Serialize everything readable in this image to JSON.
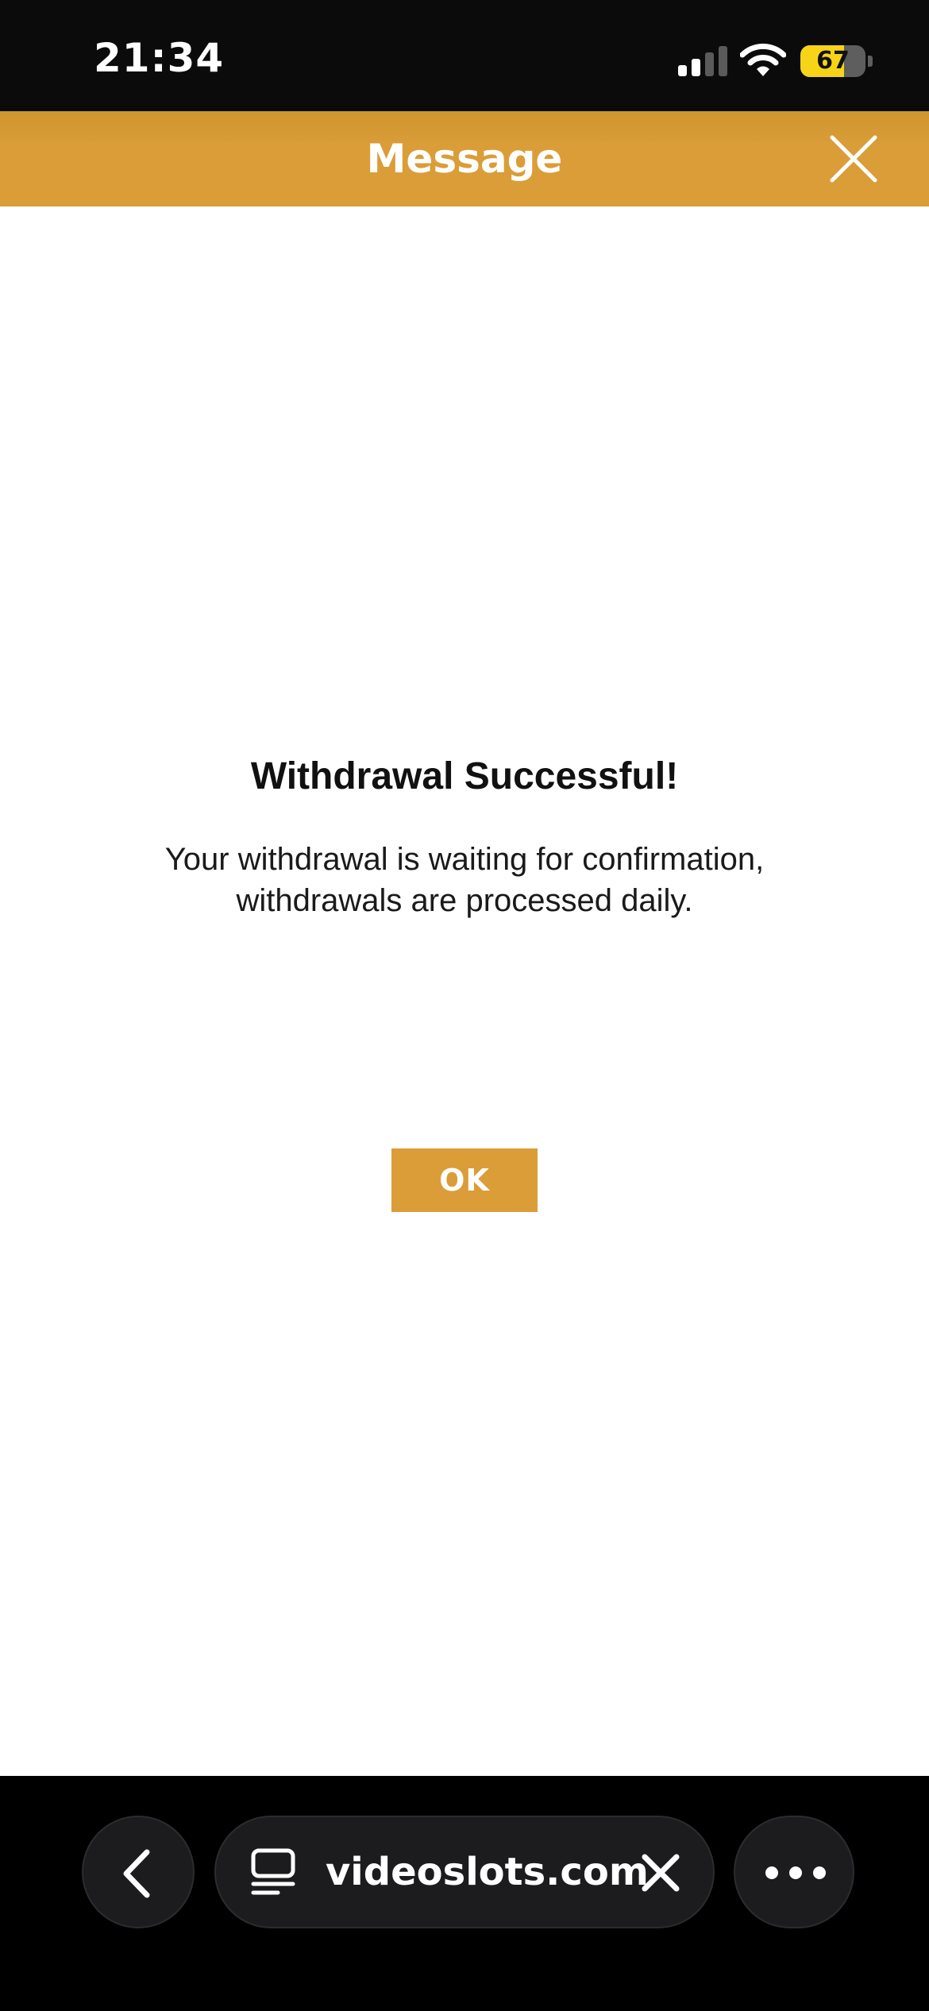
{
  "status_bar": {
    "time": "21:34",
    "battery_level": "67",
    "battery_fraction": 0.67,
    "signal_bars_active": 2,
    "signal_bars_total": 4,
    "icons": [
      "cellular-signal-icon",
      "wifi-icon",
      "battery-icon"
    ]
  },
  "header": {
    "title": "Message",
    "close_icon": "close-icon"
  },
  "dialog": {
    "title": "Withdrawal Successful!",
    "body_line1": "Your withdrawal is waiting for confirmation,",
    "body_line2": "withdrawals are processed daily.",
    "ok_label": "OK"
  },
  "browser_toolbar": {
    "url": "videoslots.com",
    "icons": [
      "back-icon",
      "tab-icon",
      "clear-url-icon",
      "more-icon"
    ]
  },
  "colors": {
    "accent": "#DA9D37",
    "status_bar_bg": "#0B0B0B",
    "content_bg": "#FFFFFF",
    "toolbar_bg": "#000000",
    "battery_fill": "#F7D417"
  }
}
